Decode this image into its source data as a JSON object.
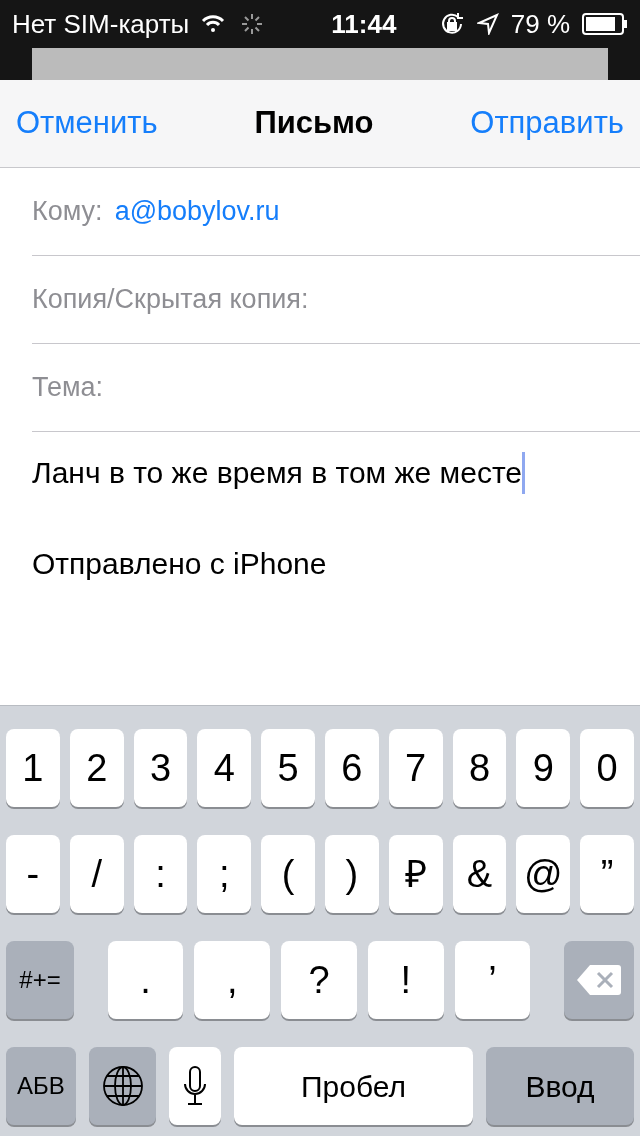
{
  "status_bar": {
    "carrier": "Нет SIM-карты",
    "time": "11:44",
    "battery": "79 %"
  },
  "nav": {
    "cancel": "Отменить",
    "title": "Письмо",
    "send": "Отправить"
  },
  "fields": [
    {
      "label": "Кому:",
      "value": "a@bobylov.ru"
    },
    {
      "label": "Копия/Скрытая копия:"
    },
    {
      "label": "Тема:"
    }
  ],
  "body": {
    "text": "Ланч в то же время в том же месте",
    "signature": "Отправлено с iPhone"
  },
  "keyboard": {
    "number_keys": [
      {
        "kind": "char",
        "label": "1"
      },
      {
        "kind": "char",
        "label": "2"
      },
      {
        "kind": "char",
        "label": "3"
      },
      {
        "kind": "char",
        "label": "4"
      },
      {
        "kind": "char",
        "label": "5"
      },
      {
        "kind": "char",
        "label": "6"
      },
      {
        "kind": "char",
        "label": "7"
      },
      {
        "kind": "char",
        "label": "8"
      },
      {
        "kind": "char",
        "label": "9"
      },
      {
        "kind": "char",
        "label": "0"
      }
    ],
    "symbol_keys": [
      {
        "kind": "char",
        "label": "-"
      },
      {
        "kind": "char",
        "label": "/"
      },
      {
        "kind": "char",
        "label": ":"
      },
      {
        "kind": "char",
        "label": ";"
      },
      {
        "kind": "char",
        "label": "("
      },
      {
        "kind": "char",
        "label": ")"
      },
      {
        "kind": "char",
        "label": "₽"
      },
      {
        "kind": "char",
        "label": "&"
      },
      {
        "kind": "char",
        "label": "@"
      },
      {
        "kind": "char",
        "label": "”"
      }
    ],
    "punctuation_row": [
      {
        "kind": "function",
        "label": "#+="
      },
      {
        "kind": "wide",
        "label": "."
      },
      {
        "kind": "wide",
        "label": ","
      },
      {
        "kind": "wide",
        "label": "?"
      },
      {
        "kind": "wide",
        "label": "!"
      },
      {
        "kind": "wide",
        "label": "’"
      },
      {
        "kind": "delete"
      }
    ],
    "bottom_row": [
      {
        "kind": "function",
        "label": "АБВ"
      },
      {
        "kind": "globe"
      },
      {
        "kind": "mic"
      },
      {
        "kind": "space",
        "label": "Пробел"
      },
      {
        "kind": "return",
        "label": "Ввод"
      }
    ]
  }
}
